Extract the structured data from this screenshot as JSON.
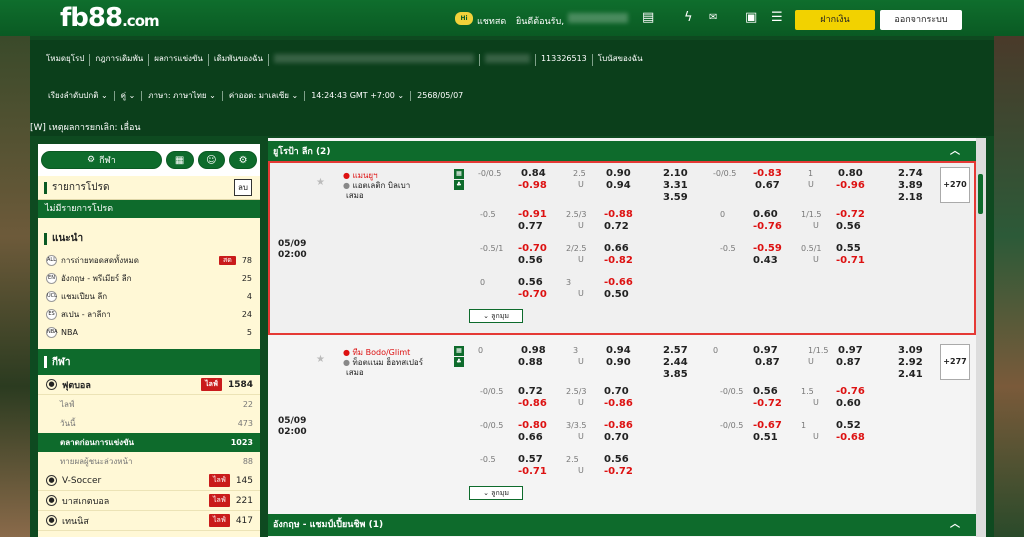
{
  "header": {
    "logo_main": "fb88",
    "logo_suffix": ".com",
    "chat_badge": "Hi",
    "chat_label": "แชทสด",
    "welcome": "ยินดีต้อนรับ,",
    "deposit_label": "ฝากเงิน",
    "logout_label": "ออกจากระบบ"
  },
  "menu": {
    "row1": [
      "โหมดยุโรป",
      "กฎการเดิมพัน",
      "ผลการแข่งขัน",
      "เดิมพันของฉัน"
    ],
    "account_id": "113326513",
    "bonus": "โบนัสของฉัน",
    "row2": [
      "เรียงลำดับปกติ",
      "คู่",
      "ภาษา: ภาษาไทย",
      "ค่าออด: มาเลเซีย",
      "14:24:43 GMT +7:00",
      "2568/05/07"
    ]
  },
  "announcement": "[W] เหตุผลการยกเลิก: เลื่อน",
  "sidebar": {
    "sports_btn": "กีฬา",
    "slip_title": "รายการโปรด",
    "slip_btn": "ลบ",
    "no_slip": "ไม่มีรายการโปรด",
    "recommend_title": "แนะนำ",
    "recommend": [
      {
        "icon": "ALL",
        "name": "การถ่ายทอดสดทั้งหมด",
        "tag": "สด",
        "count": "78"
      },
      {
        "icon": "EN",
        "name": "อังกฤษ - พรีเมียร์ ลีก",
        "tag": "",
        "count": "25"
      },
      {
        "icon": "UCL",
        "name": "แชมเปียน ลีก",
        "tag": "",
        "count": "4"
      },
      {
        "icon": "ES",
        "name": "สเปน - ลาลีกา",
        "tag": "",
        "count": "24"
      },
      {
        "icon": "NBA",
        "name": "NBA",
        "tag": "",
        "count": "5"
      }
    ],
    "sports_title": "กีฬา",
    "football": {
      "name": "ฟุตบอล",
      "tag": "ไลฟ์",
      "count": "1584"
    },
    "football_sub": [
      {
        "name": "ไลฟ์",
        "count": "22"
      },
      {
        "name": "วันนี้",
        "count": "473"
      },
      {
        "name": "ตลาดก่อนการแข่งขัน",
        "count": "1023"
      },
      {
        "name": "ทายผลผู้ชนะล่วงหน้า",
        "count": "88"
      }
    ],
    "others": [
      {
        "name": "V-Soccer",
        "tag": "ไลฟ์",
        "count": "145"
      },
      {
        "name": "บาสเกตบอล",
        "tag": "ไลฟ์",
        "count": "221"
      },
      {
        "name": "เทนนิส",
        "tag": "ไลฟ์",
        "count": "417"
      }
    ]
  },
  "leagues": [
    {
      "name": "ยูโรป้า ลีก (2)"
    },
    {
      "name": "อังกฤษ - แชมป์เปี้ยนชิพ (1)"
    }
  ],
  "matches": [
    {
      "date": "05/09",
      "time": "02:00",
      "home": "แมนยูฯ",
      "away": "แอตเลติก บิลเบา",
      "draw": "เสมอ",
      "more": "+270",
      "more_btn": "ลูกมุม",
      "ft_main": {
        "hdp": "-0/0.5",
        "h1": "0.84",
        "h2": "-0.98",
        "ou": "2.5",
        "u": "U",
        "o1": "0.90",
        "o2": "0.94",
        "x1": "2.10",
        "x2": "3.31",
        "x3": "3.59"
      },
      "ht_main": {
        "hdp": "-0/0.5",
        "h1": "-0.83",
        "h2": "0.67",
        "ou": "1",
        "u": "U",
        "o1": "0.80",
        "o2": "-0.96",
        "x1": "2.74",
        "x2": "3.89",
        "x3": "2.18"
      },
      "ft_alt": [
        {
          "hdp": "-0.5",
          "h1": "-0.91",
          "h2": "0.77",
          "ou": "2.5/3",
          "u": "U",
          "o1": "-0.88",
          "o2": "0.72"
        },
        {
          "hdp": "-0.5/1",
          "h1": "-0.70",
          "h2": "0.56",
          "ou": "2/2.5",
          "u": "U",
          "o1": "0.66",
          "o2": "-0.82"
        },
        {
          "hdp": "0",
          "h1": "0.56",
          "h2": "-0.70",
          "ou": "3",
          "u": "U",
          "o1": "-0.66",
          "o2": "0.50"
        }
      ],
      "ht_alt": [
        {
          "hdp": "0",
          "h1": "0.60",
          "h2": "-0.76",
          "ou": "1/1.5",
          "u": "U",
          "o1": "-0.72",
          "o2": "0.56"
        },
        {
          "hdp": "-0.5",
          "h1": "-0.59",
          "h2": "0.43",
          "ou": "0.5/1",
          "u": "U",
          "o1": "0.55",
          "o2": "-0.71"
        }
      ]
    },
    {
      "date": "05/09",
      "time": "02:00",
      "home": "ทีม Bodo/Glimt",
      "away": "ท็อตแนม ฮ็อทสเปอร์",
      "draw": "เสมอ",
      "more": "+277",
      "more_btn": "ลูกมุม",
      "ft_main": {
        "hdp": "0",
        "h1": "0.98",
        "h2": "0.88",
        "ou": "3",
        "u": "U",
        "o1": "0.94",
        "o2": "0.90",
        "x1": "2.57",
        "x2": "2.44",
        "x3": "3.85"
      },
      "ht_main": {
        "hdp": "0",
        "h1": "0.97",
        "h2": "0.87",
        "ou": "1/1.5",
        "u": "U",
        "o1": "0.97",
        "o2": "0.87",
        "x1": "3.09",
        "x2": "2.92",
        "x3": "2.41"
      },
      "ft_alt": [
        {
          "hdp": "-0/0.5",
          "h1": "0.72",
          "h2": "-0.86",
          "ou": "2.5/3",
          "u": "U",
          "o1": "0.70",
          "o2": "-0.86"
        },
        {
          "hdp": "-0/0.5",
          "h1": "-0.80",
          "h2": "0.66",
          "ou": "3/3.5",
          "u": "U",
          "o1": "-0.86",
          "o2": "0.70"
        },
        {
          "hdp": "-0.5",
          "h1": "0.57",
          "h2": "-0.71",
          "ou": "2.5",
          "u": "U",
          "o1": "0.56",
          "o2": "-0.72"
        }
      ],
      "ht_alt": [
        {
          "hdp": "-0/0.5",
          "h1": "0.56",
          "h2": "-0.72",
          "ou": "1.5",
          "u": "U",
          "o1": "-0.76",
          "o2": "0.60"
        },
        {
          "hdp": "-0/0.5",
          "h1": "-0.67",
          "h2": "0.51",
          "ou": "1",
          "u": "U",
          "o1": "0.52",
          "o2": "-0.68"
        }
      ]
    }
  ]
}
